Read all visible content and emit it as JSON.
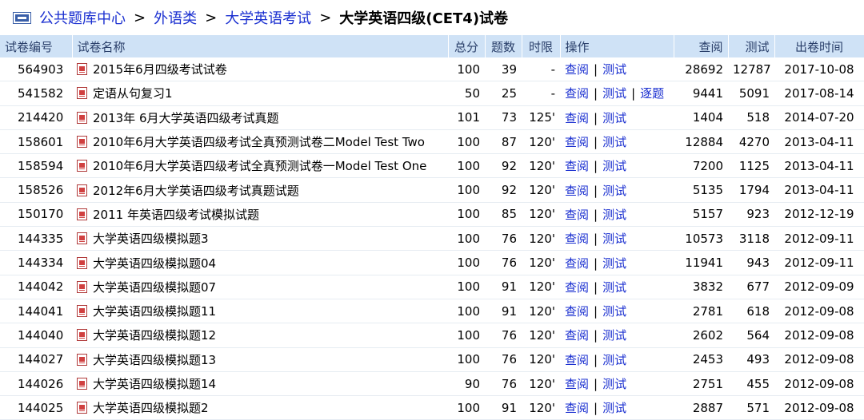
{
  "breadcrumb": {
    "items": [
      "公共题库中心",
      "外语类",
      "大学英语考试"
    ],
    "separator": ">",
    "current": "大学英语四级(CET4)试卷"
  },
  "table": {
    "headers": {
      "id": "试卷编号",
      "name": "试卷名称",
      "score": "总分",
      "count": "题数",
      "time": "时限",
      "ops": "操作",
      "views": "查阅",
      "tests": "测试",
      "date": "出卷时间"
    },
    "op_labels": {
      "view": "查阅",
      "test": "测试",
      "item": "逐题",
      "sep": "|"
    },
    "rows": [
      {
        "id": "564903",
        "name": "2015年6月四级考试试卷",
        "score": "100",
        "count": "39",
        "time": "-",
        "views": "28692",
        "tests": "12787",
        "date": "2017-10-08",
        "extra": false
      },
      {
        "id": "541582",
        "name": "定语从句复习1",
        "score": "50",
        "count": "25",
        "time": "-",
        "views": "9441",
        "tests": "5091",
        "date": "2017-08-14",
        "extra": true
      },
      {
        "id": "214420",
        "name": "2013年 6月大学英语四级考试真题",
        "score": "101",
        "count": "73",
        "time": "125'",
        "views": "1404",
        "tests": "518",
        "date": "2014-07-20",
        "extra": false
      },
      {
        "id": "158601",
        "name": "2010年6月大学英语四级考试全真预测试卷二Model Test Two",
        "score": "100",
        "count": "87",
        "time": "120'",
        "views": "12884",
        "tests": "4270",
        "date": "2013-04-11",
        "extra": false
      },
      {
        "id": "158594",
        "name": "2010年6月大学英语四级考试全真预测试卷一Model Test One",
        "score": "100",
        "count": "92",
        "time": "120'",
        "views": "7200",
        "tests": "1125",
        "date": "2013-04-11",
        "extra": false
      },
      {
        "id": "158526",
        "name": "2012年6月大学英语四级考试真题试题",
        "score": "100",
        "count": "92",
        "time": "120'",
        "views": "5135",
        "tests": "1794",
        "date": "2013-04-11",
        "extra": false
      },
      {
        "id": "150170",
        "name": "2011 年英语四级考试模拟试题",
        "score": "100",
        "count": "85",
        "time": "120'",
        "views": "5157",
        "tests": "923",
        "date": "2012-12-19",
        "extra": false
      },
      {
        "id": "144335",
        "name": "大学英语四级模拟题3",
        "score": "100",
        "count": "76",
        "time": "120'",
        "views": "10573",
        "tests": "3118",
        "date": "2012-09-11",
        "extra": false
      },
      {
        "id": "144334",
        "name": "大学英语四级模拟题04",
        "score": "100",
        "count": "76",
        "time": "120'",
        "views": "11941",
        "tests": "943",
        "date": "2012-09-11",
        "extra": false
      },
      {
        "id": "144042",
        "name": "大学英语四级模拟题07",
        "score": "100",
        "count": "91",
        "time": "120'",
        "views": "3832",
        "tests": "677",
        "date": "2012-09-09",
        "extra": false
      },
      {
        "id": "144041",
        "name": "大学英语四级模拟题11",
        "score": "100",
        "count": "91",
        "time": "120'",
        "views": "2781",
        "tests": "618",
        "date": "2012-09-08",
        "extra": false
      },
      {
        "id": "144040",
        "name": "大学英语四级模拟题12",
        "score": "100",
        "count": "76",
        "time": "120'",
        "views": "2602",
        "tests": "564",
        "date": "2012-09-08",
        "extra": false
      },
      {
        "id": "144027",
        "name": "大学英语四级模拟题13",
        "score": "100",
        "count": "76",
        "time": "120'",
        "views": "2453",
        "tests": "493",
        "date": "2012-09-08",
        "extra": false
      },
      {
        "id": "144026",
        "name": "大学英语四级模拟题14",
        "score": "90",
        "count": "76",
        "time": "120'",
        "views": "2751",
        "tests": "455",
        "date": "2012-09-08",
        "extra": false
      },
      {
        "id": "144025",
        "name": "大学英语四级模拟题2",
        "score": "100",
        "count": "91",
        "time": "120'",
        "views": "2887",
        "tests": "571",
        "date": "2012-09-08",
        "extra": false
      }
    ]
  }
}
